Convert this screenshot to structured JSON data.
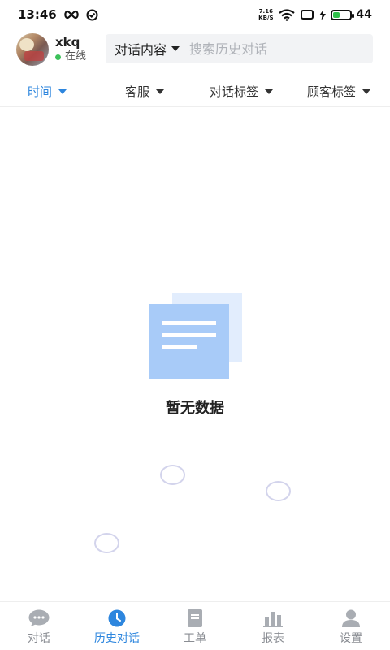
{
  "status_bar": {
    "time": "13:46",
    "net_speed_value": "7.16",
    "net_speed_unit": "KB/S",
    "battery": "44",
    "battery_level_percent": 44
  },
  "header": {
    "user_name": "xkq",
    "user_status": "在线",
    "search_type": "对话内容",
    "search_placeholder": "搜索历史对话"
  },
  "filters": [
    {
      "label": "时间",
      "active": true
    },
    {
      "label": "客服",
      "active": false
    },
    {
      "label": "对话标签",
      "active": false
    },
    {
      "label": "顾客标签",
      "active": false
    }
  ],
  "empty_state": {
    "text": "暂无数据"
  },
  "bottom_nav": [
    {
      "label": "对话",
      "icon": "chat-bubble-icon",
      "active": false
    },
    {
      "label": "历史对话",
      "icon": "clock-icon",
      "active": true
    },
    {
      "label": "工单",
      "icon": "ticket-icon",
      "active": false
    },
    {
      "label": "报表",
      "icon": "bar-chart-icon",
      "active": false
    },
    {
      "label": "设置",
      "icon": "person-icon",
      "active": false
    }
  ],
  "colors": {
    "accent": "#2d86de",
    "inactive": "#8a8d93",
    "online": "#3cc15a",
    "battery": "#2fbf4a"
  }
}
